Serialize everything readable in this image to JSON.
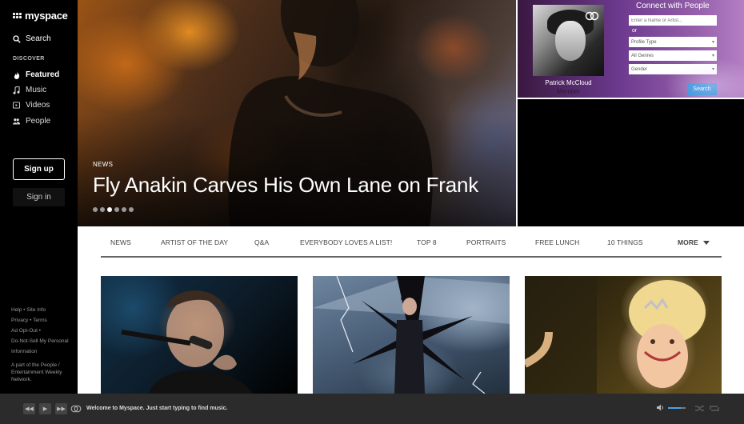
{
  "sidebar": {
    "logo": "myspace",
    "search_label": "Search",
    "discover_label": "DISCOVER",
    "items": [
      {
        "label": "Featured",
        "icon": "flame-icon"
      },
      {
        "label": "Music",
        "icon": "music-note-icon"
      },
      {
        "label": "Videos",
        "icon": "video-play-icon"
      },
      {
        "label": "People",
        "icon": "people-icon"
      }
    ],
    "signup_label": "Sign up",
    "signin_label": "Sign in",
    "footer": {
      "help": "Help",
      "site_info": "Site Info",
      "privacy": "Privacy",
      "terms": "Terms",
      "ad_opt_out": "Ad Opt-Out",
      "do_not_sell": "Do-Not-Sell My Personal Information",
      "network": "A part of the People / Entertainment Weekly Network."
    }
  },
  "hero": {
    "kicker": "NEWS",
    "title": "Fly Anakin Carves His Own Lane on Frank",
    "dots": 6,
    "active_dot": 3
  },
  "connect": {
    "title": "Connect with People",
    "member_name": "Patrick McCloud",
    "member_role": "Member",
    "name_placeholder": "Enter a Name or Artist...",
    "or_label": "or",
    "profile_type": "Profile Type",
    "genres": "All Genres",
    "gender": "Gender",
    "search_button": "Search"
  },
  "categories": [
    "NEWS",
    "ARTIST OF THE DAY",
    "Q&A",
    "EVERYBODY LOVES A LIST!",
    "TOP 8",
    "PORTRAITS",
    "FREE LUNCH",
    "10 THINGS"
  ],
  "more_label": "MORE",
  "player": {
    "message": "Welcome to Myspace. Just start typing to find music."
  },
  "colors": {
    "accent": "#1e8ad6",
    "sidebar_bg": "#000000",
    "player_bg": "#2b2b2b"
  }
}
